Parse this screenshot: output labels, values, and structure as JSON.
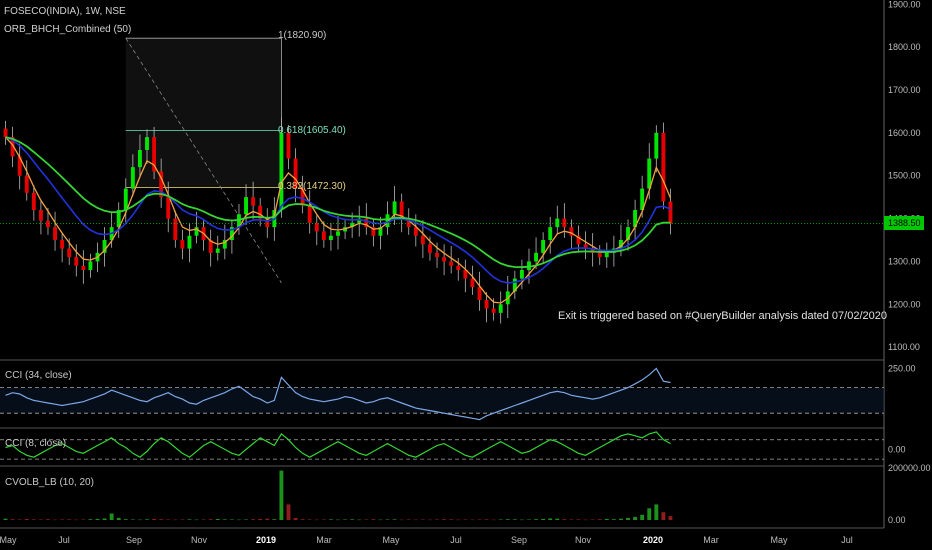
{
  "chart": {
    "symbol_line": "FOSECO(INDIA), 1W, NSE",
    "indicator_main": "ORB_BHCH_Combined (50)",
    "annotation": "Exit is triggered based on #QueryBuilder analysis dated 07/02/2020",
    "current_price": "1388.50",
    "fib_top": "1(1820.90)",
    "fib_mid": "0.618(1605.40)",
    "fib_low": "0.382(1472.30)",
    "cci1_label": "CCI (34, close)",
    "cci2_label": "CCI (8, close)",
    "vol_label": "CVOLB_LB (10, 20)",
    "colors": {
      "background": "#000000",
      "up": "#00e600",
      "down": "#e60000",
      "ma_orange": "#f5a142",
      "ma_green": "#33d633",
      "ma_blue": "#2233dd",
      "cci1": "#7ba7e8",
      "cci2": "#33d633",
      "price_line": "#00c800"
    }
  },
  "chart_data": {
    "type": "candlestick",
    "x_ticks": [
      "May",
      "Jul",
      "Sep",
      "Nov",
      "2019",
      "Mar",
      "May",
      "Jul",
      "Sep",
      "Nov",
      "2020",
      "Mar",
      "May",
      "Jul"
    ],
    "y_ticks": [
      "1100.00",
      "1200.00",
      "1300.00",
      "1400.00",
      "1500.00",
      "1600.00",
      "1700.00",
      "1800.00",
      "1900.00"
    ],
    "ylim": [
      1070,
      1910
    ],
    "cci1_ticks": [
      "250.00"
    ],
    "cci2_ticks": [
      "0.00"
    ],
    "vol_ticks": [
      "200000.00",
      "0.00"
    ],
    "close": [
      1590,
      1545,
      1500,
      1460,
      1420,
      1395,
      1380,
      1350,
      1330,
      1310,
      1290,
      1280,
      1300,
      1320,
      1350,
      1380,
      1420,
      1470,
      1520,
      1560,
      1590,
      1510,
      1450,
      1400,
      1350,
      1330,
      1360,
      1380,
      1350,
      1320,
      1330,
      1350,
      1380,
      1410,
      1450,
      1430,
      1400,
      1380,
      1420,
      1600,
      1540,
      1470,
      1430,
      1390,
      1370,
      1350,
      1360,
      1370,
      1380,
      1390,
      1400,
      1380,
      1360,
      1380,
      1410,
      1440,
      1400,
      1380,
      1360,
      1340,
      1320,
      1310,
      1300,
      1290,
      1280,
      1260,
      1240,
      1210,
      1190,
      1180,
      1200,
      1230,
      1260,
      1280,
      1300,
      1320,
      1350,
      1380,
      1400,
      1380,
      1360,
      1340,
      1330,
      1320,
      1310,
      1320,
      1330,
      1350,
      1380,
      1420,
      1470,
      1540,
      1600,
      1440,
      1388
    ],
    "cci1": [
      40,
      60,
      50,
      20,
      0,
      -10,
      -20,
      -30,
      -40,
      -30,
      -20,
      -10,
      10,
      30,
      50,
      80,
      60,
      40,
      20,
      0,
      -10,
      20,
      40,
      60,
      30,
      10,
      -20,
      -30,
      0,
      20,
      40,
      60,
      90,
      110,
      70,
      30,
      10,
      -20,
      0,
      180,
      120,
      60,
      30,
      10,
      0,
      -10,
      0,
      10,
      30,
      20,
      0,
      -20,
      -10,
      10,
      20,
      0,
      -20,
      -40,
      -60,
      -70,
      -80,
      -90,
      -100,
      -110,
      -120,
      -130,
      -140,
      -150,
      -120,
      -100,
      -80,
      -60,
      -40,
      -20,
      0,
      20,
      40,
      60,
      70,
      60,
      40,
      30,
      20,
      10,
      20,
      40,
      60,
      80,
      100,
      130,
      160,
      200,
      250,
      150,
      140
    ],
    "cci2": [
      20,
      40,
      -20,
      -60,
      -80,
      -40,
      0,
      40,
      60,
      20,
      -20,
      -40,
      0,
      40,
      80,
      120,
      60,
      20,
      -40,
      -80,
      -20,
      60,
      120,
      80,
      20,
      -40,
      -80,
      -20,
      40,
      80,
      40,
      0,
      -40,
      -60,
      0,
      60,
      120,
      80,
      40,
      160,
      100,
      20,
      -40,
      -80,
      -40,
      0,
      40,
      80,
      40,
      0,
      -40,
      -60,
      -20,
      20,
      60,
      20,
      -20,
      -60,
      -80,
      -40,
      0,
      40,
      60,
      20,
      -20,
      -60,
      -80,
      -40,
      0,
      40,
      80,
      40,
      0,
      -40,
      -20,
      20,
      60,
      100,
      80,
      40,
      0,
      -40,
      -60,
      -20,
      20,
      60,
      100,
      140,
      160,
      140,
      120,
      160,
      180,
      100,
      60
    ],
    "volume": [
      5000,
      3000,
      2000,
      4000,
      2500,
      2000,
      3000,
      1500,
      2000,
      2500,
      1500,
      2000,
      3000,
      4000,
      6000,
      25000,
      8000,
      3000,
      2000,
      1500,
      2500,
      4000,
      3000,
      2000,
      1500,
      2000,
      2500,
      1500,
      2000,
      3000,
      4000,
      2500,
      2000,
      1500,
      2000,
      3000,
      4000,
      5000,
      3000,
      190000,
      60000,
      8000,
      3000,
      2000,
      1500,
      2000,
      2500,
      1500,
      2000,
      2500,
      1500,
      2000,
      3000,
      1500,
      2000,
      2500,
      1500,
      2000,
      1500,
      2000,
      1500,
      2000,
      3000,
      2500,
      1500,
      2000,
      1500,
      2000,
      2500,
      1500,
      2000,
      3000,
      2500,
      1500,
      2000,
      3000,
      4000,
      6000,
      5000,
      3000,
      2000,
      2500,
      1500,
      2000,
      3000,
      4000,
      3000,
      5000,
      8000,
      12000,
      20000,
      45000,
      60000,
      30000,
      15000
    ]
  }
}
